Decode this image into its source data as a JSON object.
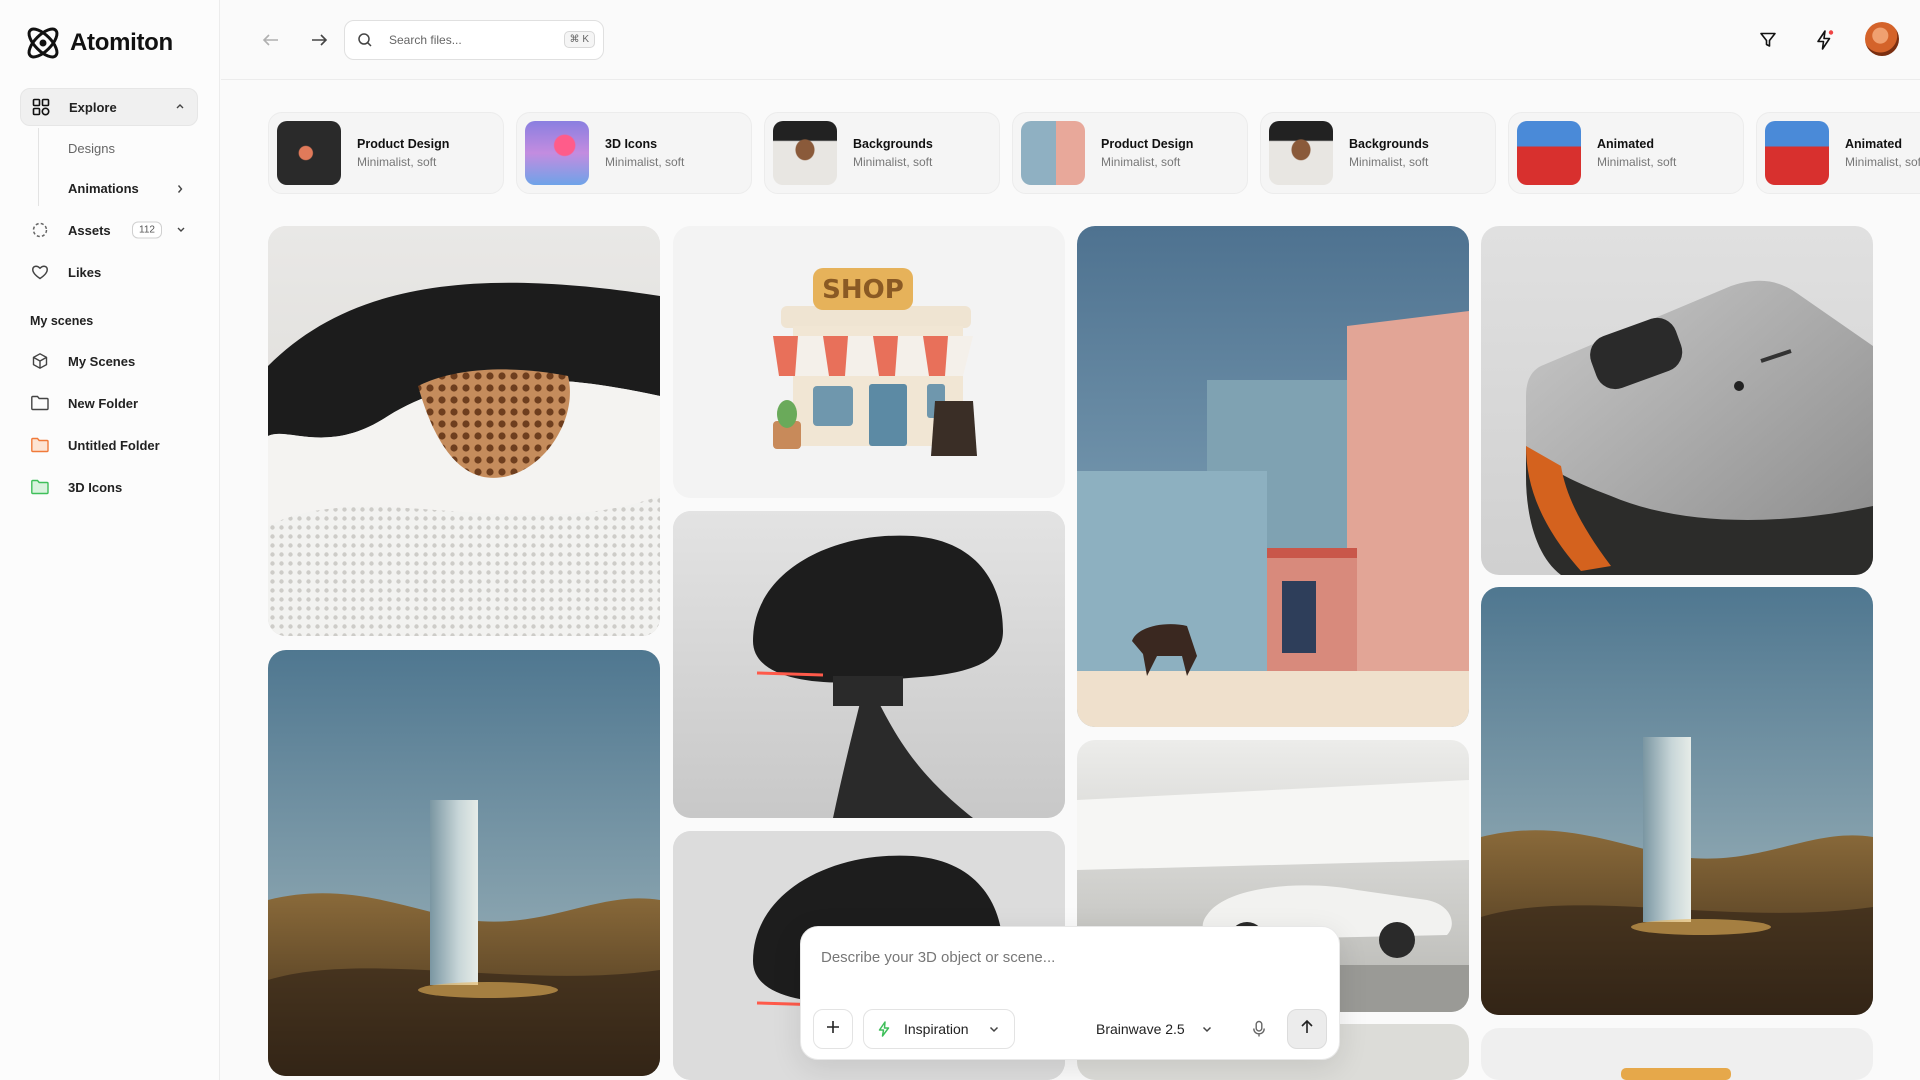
{
  "app": {
    "name": "Atomiton"
  },
  "sidebar": {
    "explore": {
      "label": "Explore",
      "icon": "grid-icon"
    },
    "sub_items": [
      {
        "label": "Designs"
      },
      {
        "label": "Animations"
      }
    ],
    "assets": {
      "label": "Assets",
      "count": "112"
    },
    "likes": {
      "label": "Likes"
    },
    "section_title": "My scenes",
    "scenes": [
      {
        "label": "My Scenes",
        "icon": "cube-icon"
      },
      {
        "label": "New Folder",
        "icon": "folder-icon"
      },
      {
        "label": "Untitled Folder",
        "icon": "folder-icon",
        "color": "#f07a3a"
      },
      {
        "label": "3D Icons",
        "icon": "folder-icon",
        "color": "#3fbf5a"
      }
    ]
  },
  "topbar": {
    "search_placeholder": "Search files...",
    "search_shortcut": "⌘ K",
    "notification_color": "#ef4444"
  },
  "categories": [
    {
      "title": "Product Design",
      "subtitle": "Minimalist, soft"
    },
    {
      "title": "3D Icons",
      "subtitle": "Minimalist, soft"
    },
    {
      "title": "Backgrounds",
      "subtitle": "Minimalist, soft"
    },
    {
      "title": "Product Design",
      "subtitle": "Minimalist, soft"
    },
    {
      "title": "Backgrounds",
      "subtitle": "Minimalist, soft"
    },
    {
      "title": "Animated",
      "subtitle": "Minimalist, soft"
    },
    {
      "title": "Animated",
      "subtitle": "Minimalist, soft"
    }
  ],
  "prompt": {
    "placeholder": "Describe your 3D object or scene...",
    "mode_label": "Inspiration",
    "model_label": "Brainwave 2.5"
  },
  "colors": {
    "accent_green": "#3fbf5a",
    "accent_orange": "#f07a3a"
  }
}
